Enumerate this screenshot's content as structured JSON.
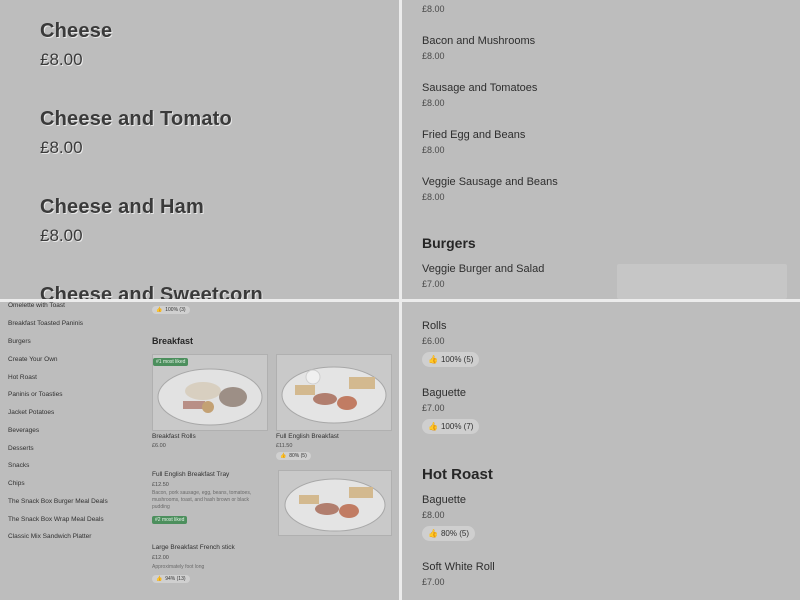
{
  "zoom_view": {
    "items": [
      {
        "name": "Cheese",
        "price": "£8.00"
      },
      {
        "name": "Cheese and Tomato",
        "price": "£8.00"
      },
      {
        "name": "Cheese and Ham",
        "price": "£8.00"
      },
      {
        "name": "Cheese and Sweetcorn"
      }
    ]
  },
  "breakfast_list": {
    "top_price": "£8.00",
    "items": [
      {
        "name": "Bacon and Mushrooms",
        "price": "£8.00"
      },
      {
        "name": "Sausage and Tomatoes",
        "price": "£8.00"
      },
      {
        "name": "Fried Egg and Beans",
        "price": "£8.00"
      },
      {
        "name": "Veggie Sausage and Beans",
        "price": "£8.00"
      }
    ],
    "section_title": "Burgers",
    "burger": {
      "name": "Veggie Burger and Salad",
      "price": "£7.00"
    }
  },
  "sidebar": {
    "items": [
      "Omelette with Toast",
      "Breakfast Toasted Paninis",
      "Burgers",
      "Create Your Own",
      "Hot Roast",
      "Paninis or Toasties",
      "Jacket Potatoes",
      "Beverages",
      "Desserts",
      "Snacks",
      "Chips",
      "The Snack Box Burger Meal Deals",
      "The Snack Box Wrap Meal Deals",
      "Classic Mix Sandwich Platter"
    ]
  },
  "menu_main": {
    "top_rating": "100% (3)",
    "section_title": "Breakfast",
    "cards": [
      {
        "badge": "#1 most liked",
        "name": "Breakfast Rolls",
        "price": "£6.00"
      },
      {
        "name": "Full English Breakfast",
        "price": "£11.50",
        "rating": "80% (5)"
      }
    ],
    "tray": {
      "name": "Full English Breakfast Tray",
      "price": "£12.50",
      "desc": "Bacon, pork sausage, egg, beans, tomatoes, mushrooms, toast, and hash brown or black pudding",
      "badge": "#2 most liked"
    },
    "stick": {
      "name": "Large Breakfast French stick",
      "price": "£12.00",
      "desc": "Approximately foot long",
      "rating": "94% (13)"
    }
  },
  "hot_list": {
    "items": [
      {
        "name": "Rolls",
        "price": "£6.00",
        "rating": "100% (5)"
      },
      {
        "name": "Baguette",
        "price": "£7.00",
        "rating": "100% (7)"
      }
    ],
    "section_title": "Hot Roast",
    "hot_items": [
      {
        "name": "Baguette",
        "price": "£8.00",
        "rating": "80% (5)"
      },
      {
        "name": "Soft White Roll",
        "price": "£7.00"
      }
    ]
  },
  "icons": {
    "rating": "thumbs-up-icon"
  }
}
